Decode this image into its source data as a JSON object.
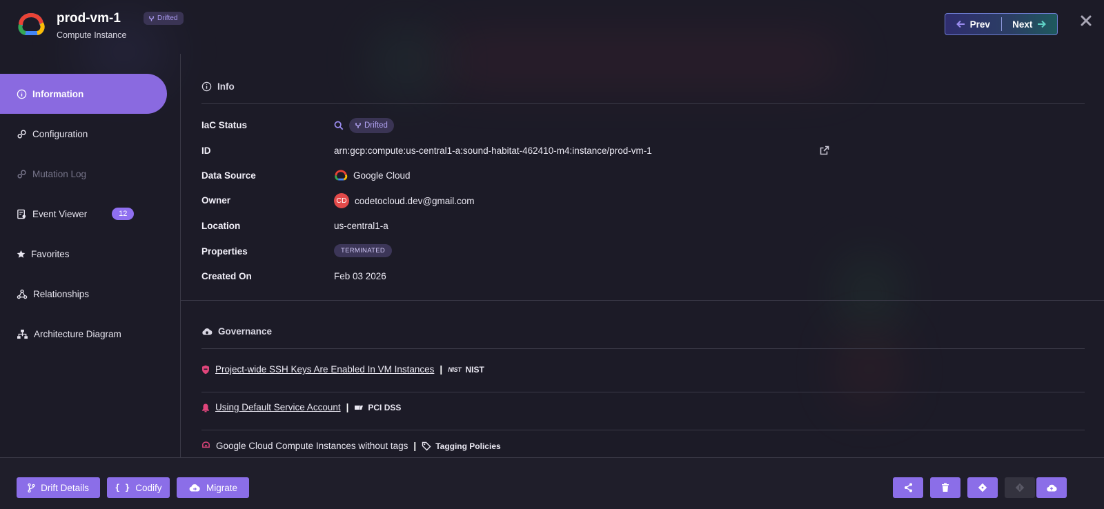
{
  "header": {
    "title": "prod-vm-1",
    "subtitle": "Compute Instance",
    "badge": "Drifted",
    "prev_label": "Prev",
    "next_label": "Next"
  },
  "sidebar": {
    "items": [
      {
        "label": "Information",
        "icon": "info-icon",
        "active": true
      },
      {
        "label": "Configuration",
        "icon": "config-icon"
      },
      {
        "label": "Mutation Log",
        "icon": "mutation-log-icon",
        "disabled": true
      },
      {
        "label": "Event Viewer",
        "icon": "event-viewer-icon",
        "count": "12"
      },
      {
        "label": "Favorites",
        "icon": "star-icon"
      },
      {
        "label": "Relationships",
        "icon": "relationships-icon"
      },
      {
        "label": "Architecture Diagram",
        "icon": "sitemap-icon"
      }
    ]
  },
  "info": {
    "section_title": "Info",
    "rows": [
      {
        "label": "IaC Status",
        "value": "Drifted"
      },
      {
        "label": "ID",
        "value": "arn:gcp:compute:us-central1-a:sound-habitat-462410-m4:instance/prod-vm-1"
      },
      {
        "label": "Data Source",
        "value": "Google Cloud"
      },
      {
        "label": "Owner",
        "value": "codetocloud.dev@gmail.com",
        "avatar": "CD"
      },
      {
        "label": "Location",
        "value": "us-central1-a"
      },
      {
        "label": "Properties",
        "value": "TERMINATED"
      },
      {
        "label": "Created On",
        "value": "Feb 03 2026"
      }
    ]
  },
  "governance": {
    "section_title": "Governance",
    "items": [
      {
        "title": "Project-wide SSH Keys Are Enabled In VM Instances",
        "framework": "NIST",
        "framework_logo": "NIST"
      },
      {
        "title": "Using Default Service Account",
        "framework": "PCI DSS"
      },
      {
        "title": "Google Cloud Compute Instances without tags",
        "framework": "Tagging Policies"
      }
    ]
  },
  "footer": {
    "drift_details": "Drift Details",
    "codify": "Codify",
    "migrate": "Migrate"
  },
  "colors": {
    "accent": "#8b6ee8",
    "background": "#1c1b27",
    "danger_icon": "#e0457b"
  }
}
